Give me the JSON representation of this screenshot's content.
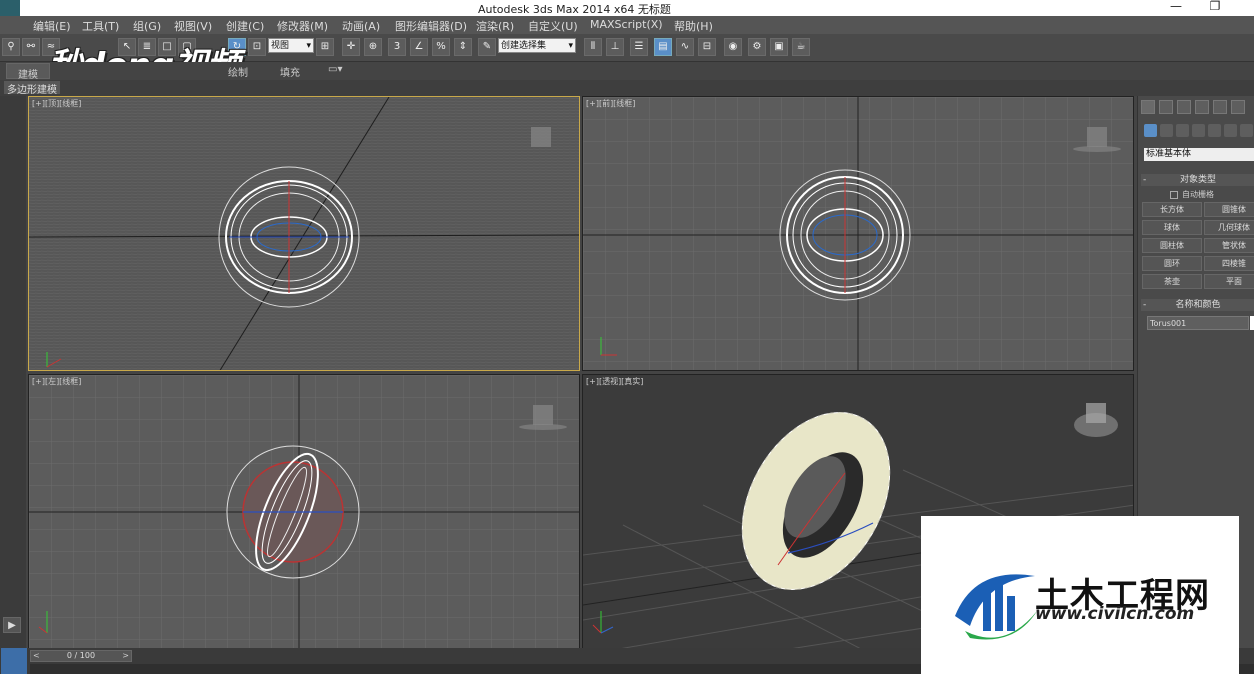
{
  "window": {
    "title": "Autodesk 3ds Max  2014 x64      无标题",
    "minimize_glyph": "—",
    "maximize_glyph": "❐"
  },
  "menu": [
    {
      "label": "编辑(E)",
      "x": 0
    },
    {
      "label": "工具(T)"
    },
    {
      "label": "组(G)"
    },
    {
      "label": "视图(V)"
    },
    {
      "label": "创建(C)"
    },
    {
      "label": "修改器(M)"
    },
    {
      "label": "动画(A)"
    },
    {
      "label": "图形编辑器(D)"
    },
    {
      "label": "渲染(R)"
    },
    {
      "label": "自定义(U)"
    },
    {
      "label": "MAXScript(X)"
    },
    {
      "label": "帮助(H)"
    }
  ],
  "toolbar": {
    "view_dropdown": "视图",
    "selection_set_dropdown": "创建选择集",
    "snap_label": "3",
    "angle_snap_label": "%"
  },
  "ribbon": {
    "tabs": [
      "建模",
      "绘制",
      "填充"
    ],
    "sub_label": "多边形建模"
  },
  "watermark_top": "秒dong视频",
  "viewports": {
    "top": "[+][顶][线框]",
    "front": "[+][前][线框]",
    "left": "[+][左][线框]",
    "persp": "[+][透视][真实]"
  },
  "command_panel": {
    "dropdown": "标准基本体",
    "object_type_title": "对象类型",
    "auto_grid": "自动栅格",
    "object_buttons": [
      "长方体",
      "圆锥体",
      "球体",
      "几何球体",
      "圆柱体",
      "管状体",
      "圆环",
      "四棱锥",
      "茶壶",
      "平面"
    ],
    "name_color_title": "名称和颜色",
    "object_name": "Torus001"
  },
  "timeline": {
    "frame": "0 / 100",
    "prev": "<",
    "next": ">"
  },
  "watermark_bottom": {
    "cn": "土木工程网",
    "url": "www.civilcn.com"
  },
  "colors": {
    "accent": "#5a8fc8",
    "viewport_active_border": "#c9a94a",
    "torus_wire": "#ffffff",
    "torus_shaded": "#e8e6c8"
  }
}
